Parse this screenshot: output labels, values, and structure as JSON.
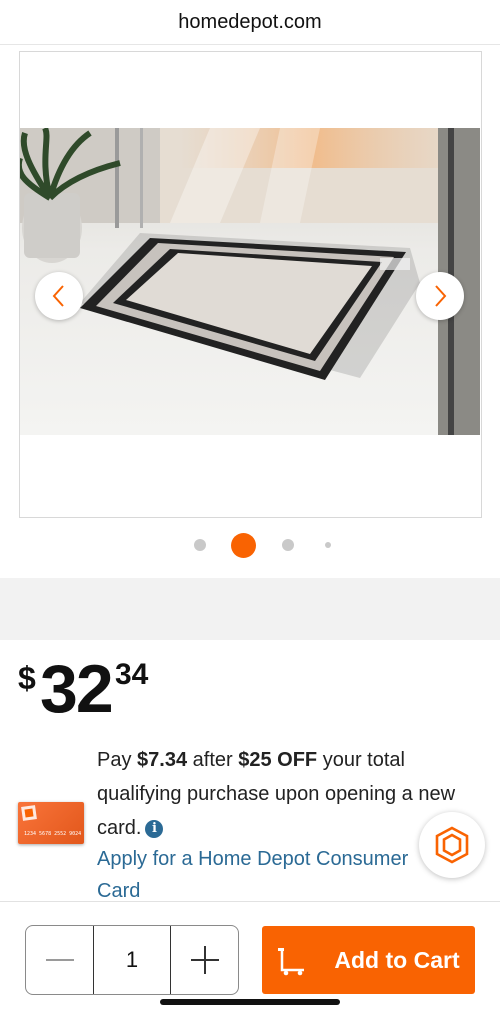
{
  "browser": {
    "url": "homedepot.com"
  },
  "gallery": {
    "image_alt": "Door mat on tiled floor",
    "prev_icon": "chevron-left-icon",
    "next_icon": "chevron-right-icon",
    "dot_count": 4,
    "active_dot_index": 1
  },
  "price": {
    "currency": "$",
    "dollars": "32",
    "cents": "34"
  },
  "promo": {
    "text_1": "Pay ",
    "amount": "$7.34",
    "text_2": " after ",
    "discount": "$25 OFF",
    "text_3": " your total qualifying purchase upon opening a new card.",
    "info_icon": "i",
    "apply_link": "Apply for a Home Depot Consumer Card",
    "card_number": "1234 5678 2552 9024"
  },
  "cart": {
    "quantity": "1",
    "minus_icon": "minus-icon",
    "plus_icon": "plus-icon",
    "add_label": "Add to Cart"
  },
  "colors": {
    "brand_orange": "#f96302",
    "link_blue": "#2b6a95"
  }
}
